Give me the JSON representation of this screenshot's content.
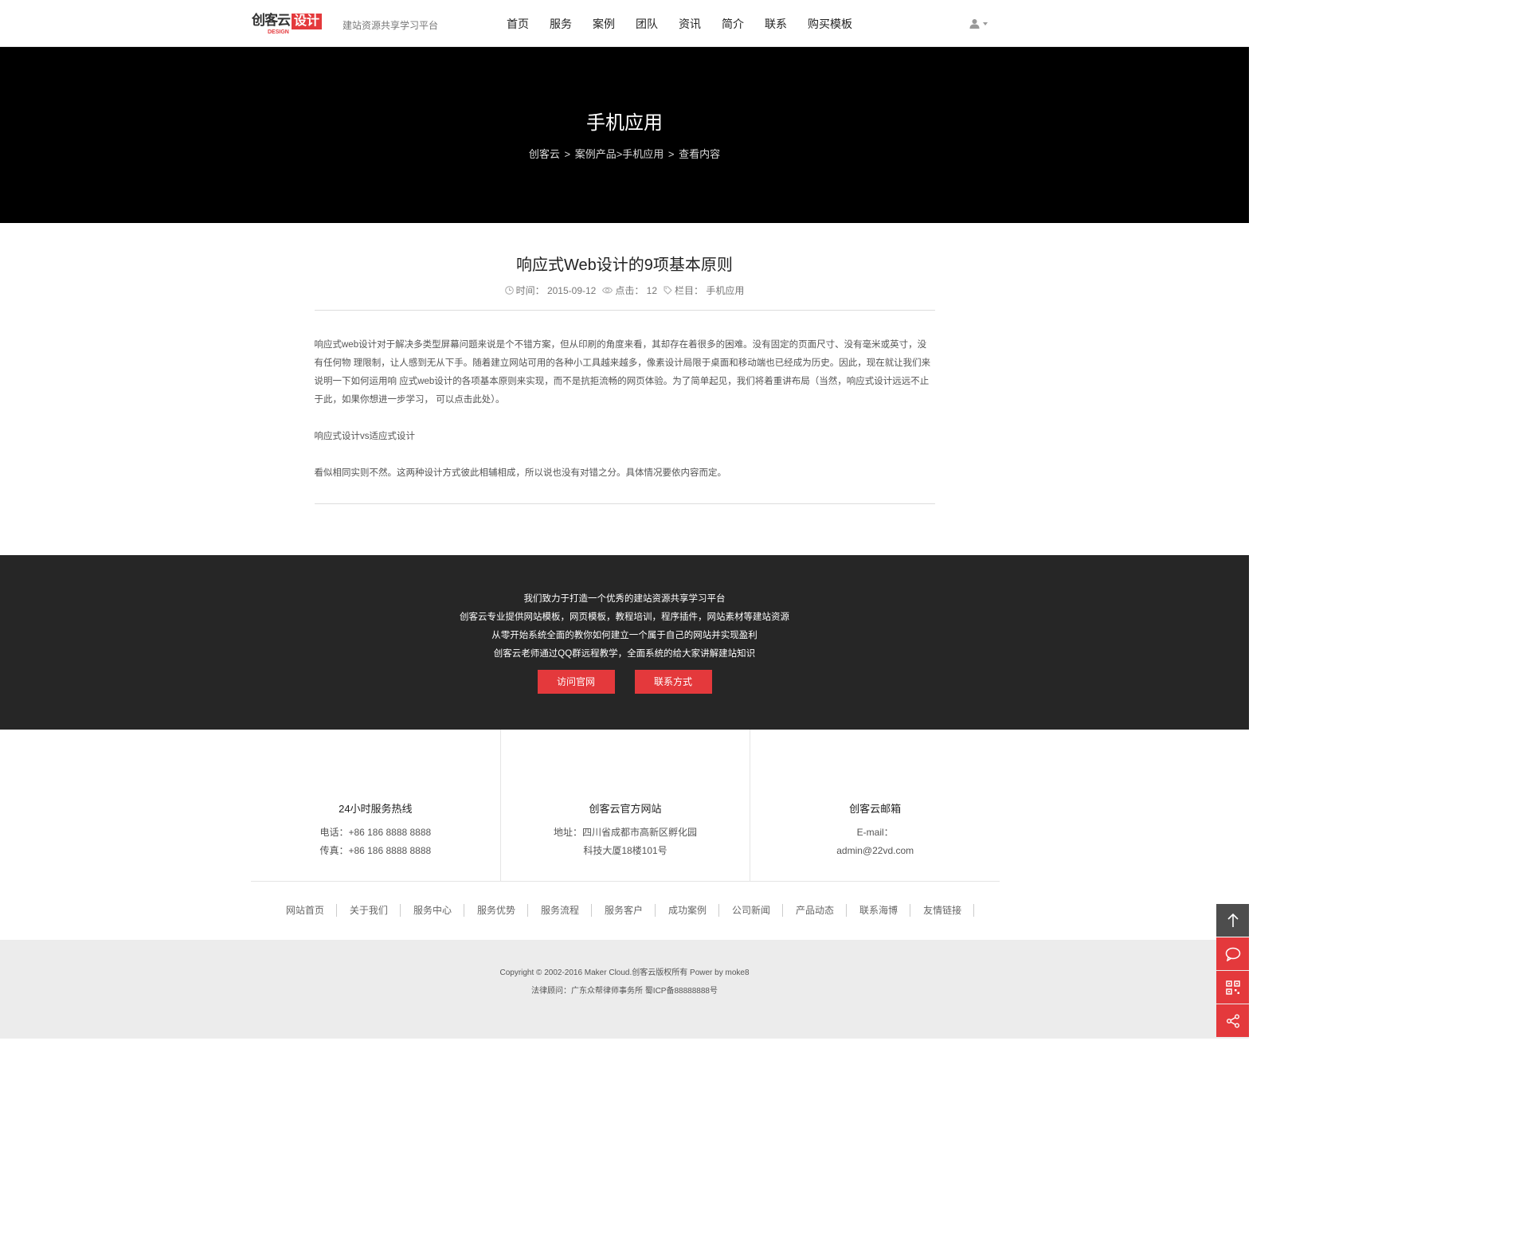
{
  "header": {
    "logo_text": "创客云",
    "logo_sub": "DESIGN",
    "logo_box": "设计",
    "slogan": "建站资源共享学习平台",
    "nav": [
      "首页",
      "服务",
      "案例",
      "团队",
      "资讯",
      "简介",
      "联系",
      "购买模板"
    ]
  },
  "banner": {
    "title": "手机应用",
    "crumbs": [
      "创客云",
      ">",
      "案例产品>手机应用",
      ">",
      "查看内容"
    ]
  },
  "article": {
    "title": "响应式Web设计的9项基本原则",
    "time": "时间： 2015-09-12",
    "clicks": "点击： 12",
    "column": "栏目： 手机应用",
    "paragraphs": [
      "响应式web设计对于解决多类型屏幕问题来说是个不错方案，但从印刷的角度来看，其却存在着很多的困难。没有固定的页面尺寸、没有毫米或英寸，没有任何物 理限制，让人感到无从下手。随着建立网站可用的各种小工具越来越多，像素设计局限于桌面和移动端也已经成为历史。因此，现在就让我们来说明一下如何运用响 应式web设计的各项基本原则来实现，而不是抗拒流畅的网页体验。为了简单起见，我们将着重讲布局（当然，响应式设计远远不止于此，如果你想进一步学习， 可以点击此处）。",
      "响应式设计vs适应式设计",
      "看似相同实则不然。这两种设计方式彼此相辅相成，所以说也没有对错之分。具体情况要依内容而定。"
    ]
  },
  "promo": {
    "lines": [
      "我们致力于打造一个优秀的建站资源共享学习平台",
      "创客云专业提供网站模板，网页模板，教程培训，程序插件，网站素材等建站资源",
      "从零开始系统全面的教你如何建立一个属于自己的网站并实现盈利",
      "创客云老师通过QQ群远程教学，全面系统的给大家讲解建站知识"
    ],
    "btn_visit": "访问官网",
    "btn_contact": "联系方式"
  },
  "contact": {
    "cols": [
      {
        "title": "24小时服务热线",
        "line1": "电话：+86 186 8888 8888",
        "line2": "传真：+86 186 8888 8888"
      },
      {
        "title": "创客云官方网站",
        "line1": "地址：四川省成都市高新区孵化园",
        "line2": "科技大厦18楼101号"
      },
      {
        "title": "创客云邮箱",
        "line1": "E-mail：",
        "line2": "admin@22vd.com"
      }
    ]
  },
  "links": [
    "网站首页",
    "关于我们",
    "服务中心",
    "服务优势",
    "服务流程",
    "服务客户",
    "成功案例",
    "公司新闻",
    "产品动态",
    "联系海博",
    "友情链接"
  ],
  "footer": {
    "copyright": "Copyright © 2002-2016 Maker Cloud.创客云版权所有 Power by moke8",
    "legal": "法律顾问：广东众帮律师事务所 蜀ICP备88888888号"
  },
  "colors": {
    "accent": "#e4393c",
    "banner_bg": "#000000",
    "promo_bg": "#262626",
    "footer_bg": "#ececec"
  },
  "icons": [
    "user-icon",
    "clock-icon",
    "eye-icon",
    "tag-icon",
    "arrow-up-icon",
    "chat-icon",
    "qrcode-icon",
    "share-icon"
  ]
}
